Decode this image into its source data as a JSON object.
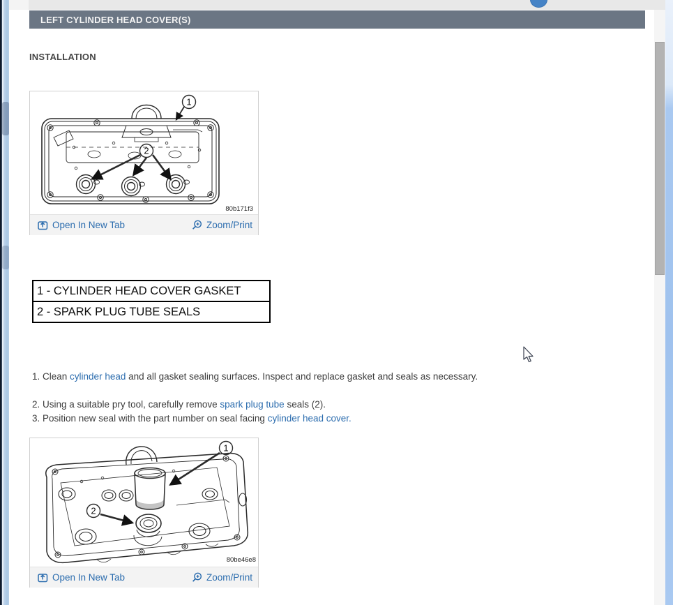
{
  "header": {
    "title": "LEFT CYLINDER HEAD COVER(S)"
  },
  "section": {
    "heading": "INSTALLATION"
  },
  "figures": [
    {
      "code": "80b171f3",
      "open_label": "Open In New Tab",
      "zoom_label": "Zoom/Print",
      "callout1": "1",
      "callout2": "2"
    },
    {
      "code": "80be46e8",
      "open_label": "Open In New Tab",
      "zoom_label": "Zoom/Print",
      "callout1": "1",
      "callout2": "2"
    }
  ],
  "legend": {
    "rows": [
      "1 - CYLINDER HEAD COVER GASKET",
      "2 - SPARK PLUG TUBE SEALS"
    ]
  },
  "steps": [
    {
      "pre": "1. Clean ",
      "link": "cylinder head",
      "post": " and all gasket sealing surfaces. Inspect and replace gasket and seals as necessary."
    },
    {
      "pre": "2. Using a suitable pry tool, carefully remove ",
      "link": "spark plug tube",
      "post": " seals (2)."
    },
    {
      "pre": "3. Position new seal with the part number on seal facing ",
      "link": "cylinder head cover.",
      "post": ""
    }
  ],
  "icons": {
    "open_in_new_tab": "boxed-up-arrow",
    "zoom_print": "magnifier-plus"
  },
  "colors": {
    "header_bg": "#6b7684",
    "link": "#2b6cae",
    "body_text": "#3c3c3c",
    "scrollbar_thumb": "#b3b3b3",
    "edge_blue": "#aac6e4"
  }
}
